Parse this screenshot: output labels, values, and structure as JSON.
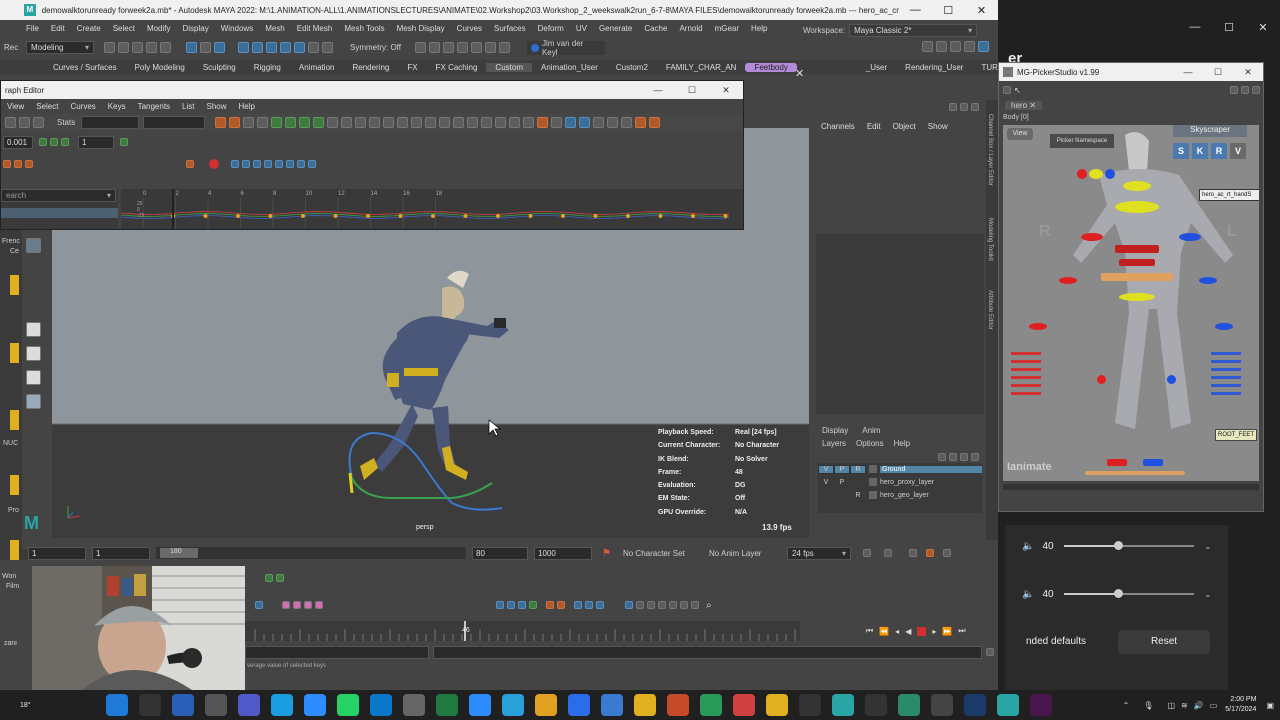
{
  "maya": {
    "title": "demowalktorunready forweek2a.mb* - Autodesk MAYA 2022: M:\\1.ANIMATION-ALL\\1.ANIMATIONSLECTURES\\ANIMATE\\02.Workshop2\\03.Workshop_2_weekswalk2run_6-7-8\\MAYA FILES\\demowalktorunready forweek2a.mb  ---  hero_ac_cn_c...",
    "menus": [
      "File",
      "Edit",
      "Create",
      "Select",
      "Modify",
      "Display",
      "Windows",
      "Mesh",
      "Edit Mesh",
      "Mesh Tools",
      "Mesh Display",
      "Curves",
      "Surfaces",
      "Deform",
      "UV",
      "Generate",
      "Cache",
      "Arnold",
      "mGear",
      "Help"
    ],
    "menu_set": "Modeling",
    "symmetry": "Symmetry: Off",
    "user": "Jim van der Keyl",
    "workspace_label": "Workspace:",
    "workspace": "Maya Classic 2*",
    "shelf_tabs": [
      "Curves / Surfaces",
      "Poly Modeling",
      "Sculpting",
      "Rigging",
      "Animation",
      "Rendering",
      "FX",
      "FX Caching",
      "Custom",
      "Animation_User",
      "Custom2",
      "FAMILY_CHAR_AN",
      "Feetbody",
      "_User",
      "Rendering_User",
      "TURTLE_User"
    ],
    "left_shelf_stub": "Rec",
    "side_stubs": [
      "Frenc",
      "Ce",
      "NUC",
      "Pro",
      "Won",
      "Film",
      "zani"
    ],
    "right_dock_tabs": [
      "Channel Box / Layer Editor",
      "Modeling Toolkit",
      "Attribute Editor"
    ]
  },
  "graph_editor": {
    "title": "raph Editor",
    "menus": [
      "View",
      "Select",
      "Curves",
      "Keys",
      "Tangents",
      "List",
      "Show",
      "Help"
    ],
    "stats_label": "Stats",
    "value_field": "0.001",
    "step_field": "1",
    "search_placeholder": "earch",
    "frame_ticks": [
      "0",
      "2",
      "4",
      "6",
      "8",
      "10",
      "12",
      "14",
      "16",
      "18"
    ],
    "value_ticks": [
      "25",
      "0",
      "-25"
    ]
  },
  "channel_box": {
    "menus": [
      "Channels",
      "Edit",
      "Object",
      "Show"
    ],
    "tabs": [
      "Display",
      "Anim"
    ],
    "sub_menus": [
      "Layers",
      "Options",
      "Help"
    ],
    "layers": [
      {
        "v": "V",
        "p": "P",
        "r": "R",
        "name": "Ground",
        "selected": true
      },
      {
        "v": "V",
        "p": "P",
        "r": "",
        "name": "hero_proxy_layer",
        "selected": false
      },
      {
        "v": "",
        "p": "",
        "r": "R",
        "name": "hero_geo_layer",
        "selected": false
      }
    ]
  },
  "viewport": {
    "camera": "persp",
    "fps_readout": "13.9 fps",
    "hud": [
      {
        "k": "Playback Speed:",
        "v": "Real [24 fps]"
      },
      {
        "k": "Current Character:",
        "v": "No Character"
      },
      {
        "k": "IK Blend:",
        "v": "No Solver"
      },
      {
        "k": "Frame:",
        "v": "48"
      },
      {
        "k": "Evaluation:",
        "v": "DG"
      },
      {
        "k": "EM State:",
        "v": "Off"
      },
      {
        "k": "GPU Override:",
        "v": "N/A"
      }
    ]
  },
  "range_slider": {
    "start": "1",
    "inner_start": "1",
    "inner_end_label": "180",
    "end": "80",
    "max": "1000",
    "character_set": "No Character Set",
    "anim_layer": "No Anim Layer",
    "fps": "24 fps"
  },
  "timeline": {
    "current_frame": "46",
    "status_text": "verage value of selected keys"
  },
  "picker": {
    "title": "MG-PickerStudio v1.99",
    "tab": "hero",
    "body_label": "Body [0]",
    "view_btn": "View",
    "namespace_btn": "Picker Namespace",
    "skyscraper": "Skyscraper",
    "mode_buttons": [
      "S",
      "K",
      "R",
      "V"
    ],
    "hand_label": "hero_ac_rt_handS",
    "root_feet": "ROOT_FEET",
    "side_l": "L",
    "side_r": "R",
    "watermark": "Ianimate"
  },
  "bg_window": {
    "title_fragment": "er",
    "volume_1": "40",
    "volume_2": "40",
    "defaults_text": "nded defaults",
    "reset": "Reset"
  },
  "taskbar": {
    "weather": "18°",
    "time": "2:00 PM",
    "date": "5/17/2024",
    "apps": [
      "start-icon",
      "search-icon",
      "copilot-icon",
      "file-icon",
      "teams-icon",
      "skype-icon",
      "zoom-icon",
      "whatsapp-icon",
      "edge-icon",
      "gear-icon",
      "excel-icon",
      "browser-icon",
      "telegram-icon",
      "chrome-icon",
      "messenger-icon",
      "store-icon",
      "folder-icon",
      "powerpoint-icon",
      "lock-icon",
      "paint-icon",
      "chrome2-icon",
      "openai-icon",
      "maya-icon",
      "github-icon",
      "vpn-icon",
      "notion-icon",
      "steam-icon",
      "maya2-icon",
      "slack-icon"
    ]
  },
  "colors": {
    "maya_bg": "#444444",
    "viewport_sky": "#8e959b",
    "viewport_ground": "#3c3c3c",
    "selected_layer": "#5285a6",
    "accent_blue": "#2e6fd1"
  }
}
